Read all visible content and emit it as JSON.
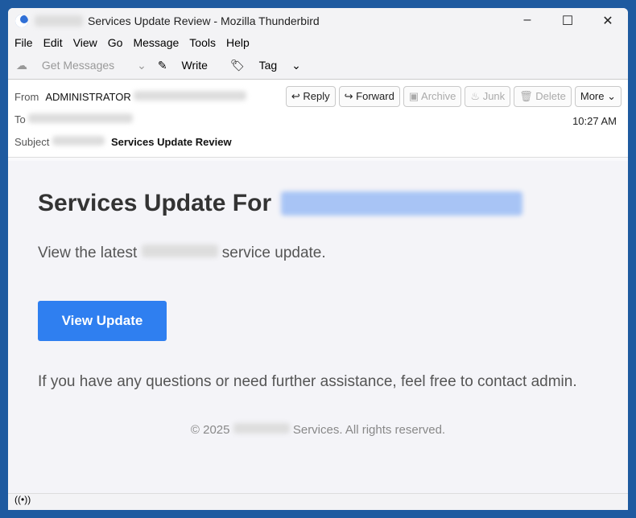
{
  "window": {
    "title": "Services Update Review - Mozilla Thunderbird",
    "controls": [
      "–",
      "☐",
      "✕"
    ]
  },
  "menu": [
    "File",
    "Edit",
    "View",
    "Go",
    "Message",
    "Tools",
    "Help"
  ],
  "toolbar": {
    "get_messages": "Get Messages",
    "write": "Write",
    "tag": "Tag"
  },
  "header": {
    "from_label": "From",
    "from": "ADMINISTRATOR",
    "to_label": "To",
    "subject_label": "Subject",
    "subject": "Services Update Review",
    "time": "10:27 AM",
    "buttons": {
      "reply": "Reply",
      "forward": "Forward",
      "archive": "Archive",
      "junk": "Junk",
      "delete": "Delete",
      "more": "More"
    }
  },
  "email": {
    "heading": "Services Update For",
    "line1a": "View the latest",
    "line1b": "service update.",
    "cta": "View Update",
    "help": "If you have any questions or need further assistance, feel free to contact admin.",
    "footer_a": "© 2025",
    "footer_b": "Services. All rights reserved."
  },
  "status": {
    "icon": "((•))"
  }
}
